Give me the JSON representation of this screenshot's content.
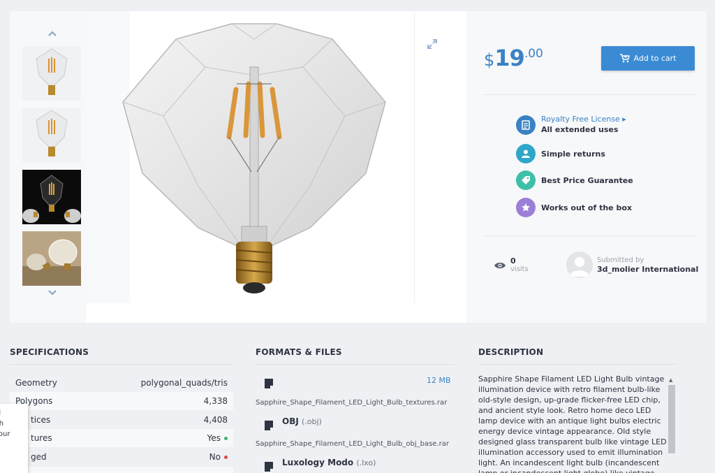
{
  "product": {
    "price": {
      "currency": "$",
      "int": "19",
      "cents": ".00"
    },
    "cart_label": "Add to cart"
  },
  "features": [
    {
      "link": "Royalty Free License ▸",
      "text": "All extended uses",
      "icon": "document-icon",
      "color": "#3b82c4"
    },
    {
      "text": "Simple returns",
      "icon": "user-icon",
      "color": "#2fa7c9"
    },
    {
      "text": "Best Price Guarantee",
      "icon": "tag-icon",
      "color": "#3fbfa8"
    },
    {
      "text": "Works out of the box",
      "icon": "star-icon",
      "color": "#9b7fd6"
    }
  ],
  "stats": {
    "visits_count": "0",
    "visits_label": "visits"
  },
  "submitter": {
    "label": "Submitted by",
    "name": "3d_molier International"
  },
  "sections": {
    "specs": "SPECIFICATIONS",
    "formats": "FORMATS & FILES",
    "description": "DESCRIPTION"
  },
  "specs": [
    {
      "label": "Geometry",
      "value": "polygonal_quads/tris"
    },
    {
      "label": "Polygons",
      "value": "4,338"
    },
    {
      "label": "tices",
      "value": "4,408"
    },
    {
      "label": "tures",
      "value": "Yes",
      "dot": "#3cb371"
    },
    {
      "label": "ged",
      "value": "No",
      "dot": "#e0474c"
    }
  ],
  "files": [
    {
      "size": "12 MB",
      "name": "Sapphire_Shape_Filament_LED_Light_Bulb_textures.rar"
    },
    {
      "format": "OBJ",
      "ext": "(.obj)",
      "name": "Sapphire_Shape_Filament_LED_Light_Bulb_obj_base.rar"
    },
    {
      "format": "Luxology Modo",
      "ext": "(.lxo)"
    }
  ],
  "description": "Sapphire Shape Filament LED Light Bulb vintage illumination device with retro filament bulb-like old-style design, up-grade flicker-free LED chip, and ancient style look. Retro home deco LED lamp device with an antique light bulbs electric energy device vintage appearance. Old style designed glass transparent bulb like vintage LED illumination accessory used to emit illumination light. An incandescent light bulb (incandescent lamp or incandescent light globe) like vintage design an",
  "popup_lines": [
    "ul",
    "ith",
    "your"
  ]
}
